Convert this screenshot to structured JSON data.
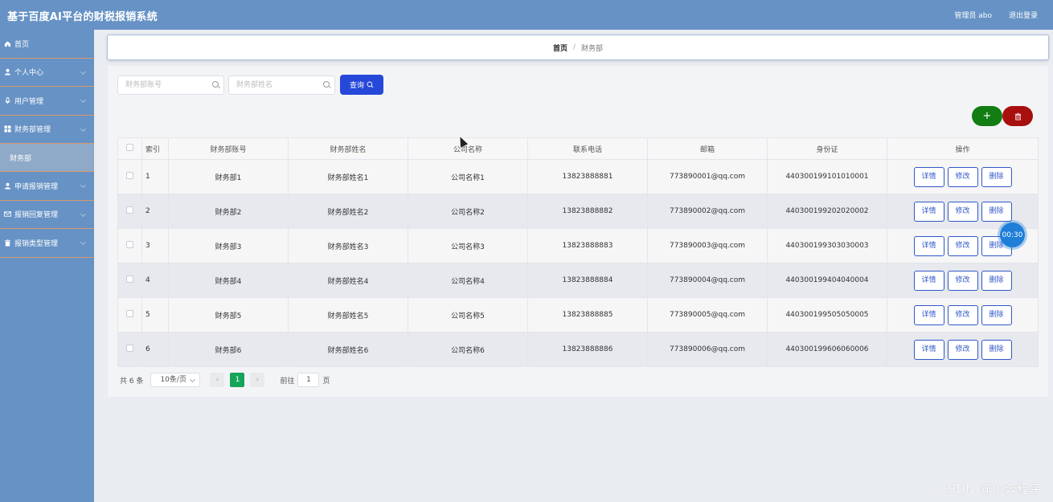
{
  "header": {
    "title": "基于百度AI平台的财税报销系统",
    "user": "管理员 abo",
    "logout": "退出登录"
  },
  "sidebar": {
    "items": [
      {
        "label": "首页",
        "icon": "home-icon"
      },
      {
        "label": "个人中心",
        "icon": "user-icon"
      },
      {
        "label": "用户管理",
        "icon": "mic-icon"
      },
      {
        "label": "财务部管理",
        "icon": "grid-icon"
      },
      {
        "label": "申请报销管理",
        "icon": "user-icon"
      },
      {
        "label": "报销回复管理",
        "icon": "mail-icon"
      },
      {
        "label": "报销类型管理",
        "icon": "trash-icon"
      }
    ],
    "sub_active": "财务部"
  },
  "breadcrumb": {
    "home": "首页",
    "sep": "/",
    "current": "财务部"
  },
  "search": {
    "account_placeholder": "财务部账号",
    "name_placeholder": "财务部姓名",
    "button": "查询"
  },
  "actions": {
    "add": "+",
    "delete": "🗑"
  },
  "table": {
    "headers": [
      "",
      "索引",
      "财务部账号",
      "财务部姓名",
      "公司名称",
      "联系电话",
      "邮箱",
      "身份证",
      "操作"
    ],
    "ops": [
      "详情",
      "修改",
      "删除"
    ],
    "rows": [
      {
        "idx": "1",
        "account": "财务部1",
        "name": "财务部姓名1",
        "company": "公司名称1",
        "phone": "13823888881",
        "email": "773890001@qq.com",
        "id": "440300199101010001"
      },
      {
        "idx": "2",
        "account": "财务部2",
        "name": "财务部姓名2",
        "company": "公司名称2",
        "phone": "13823888882",
        "email": "773890002@qq.com",
        "id": "440300199202020002"
      },
      {
        "idx": "3",
        "account": "财务部3",
        "name": "财务部姓名3",
        "company": "公司名称3",
        "phone": "13823888883",
        "email": "773890003@qq.com",
        "id": "440300199303030003"
      },
      {
        "idx": "4",
        "account": "财务部4",
        "name": "财务部姓名4",
        "company": "公司名称4",
        "phone": "13823888884",
        "email": "773890004@qq.com",
        "id": "440300199404040004"
      },
      {
        "idx": "5",
        "account": "财务部5",
        "name": "财务部姓名5",
        "company": "公司名称5",
        "phone": "13823888885",
        "email": "773890005@qq.com",
        "id": "440300199505050005"
      },
      {
        "idx": "6",
        "account": "财务部6",
        "name": "财务部姓名6",
        "company": "公司名称6",
        "phone": "13823888886",
        "email": "773890006@qq.com",
        "id": "440300199606060006"
      }
    ]
  },
  "pager": {
    "total": "共 6 条",
    "size": "10条/页",
    "prev": "‹",
    "page": "1",
    "next": "›",
    "goto": "前往",
    "jump": "1",
    "unit": "页"
  },
  "overlay": {
    "timer": "00:30",
    "watermark": "CSDN @小奔程序"
  }
}
